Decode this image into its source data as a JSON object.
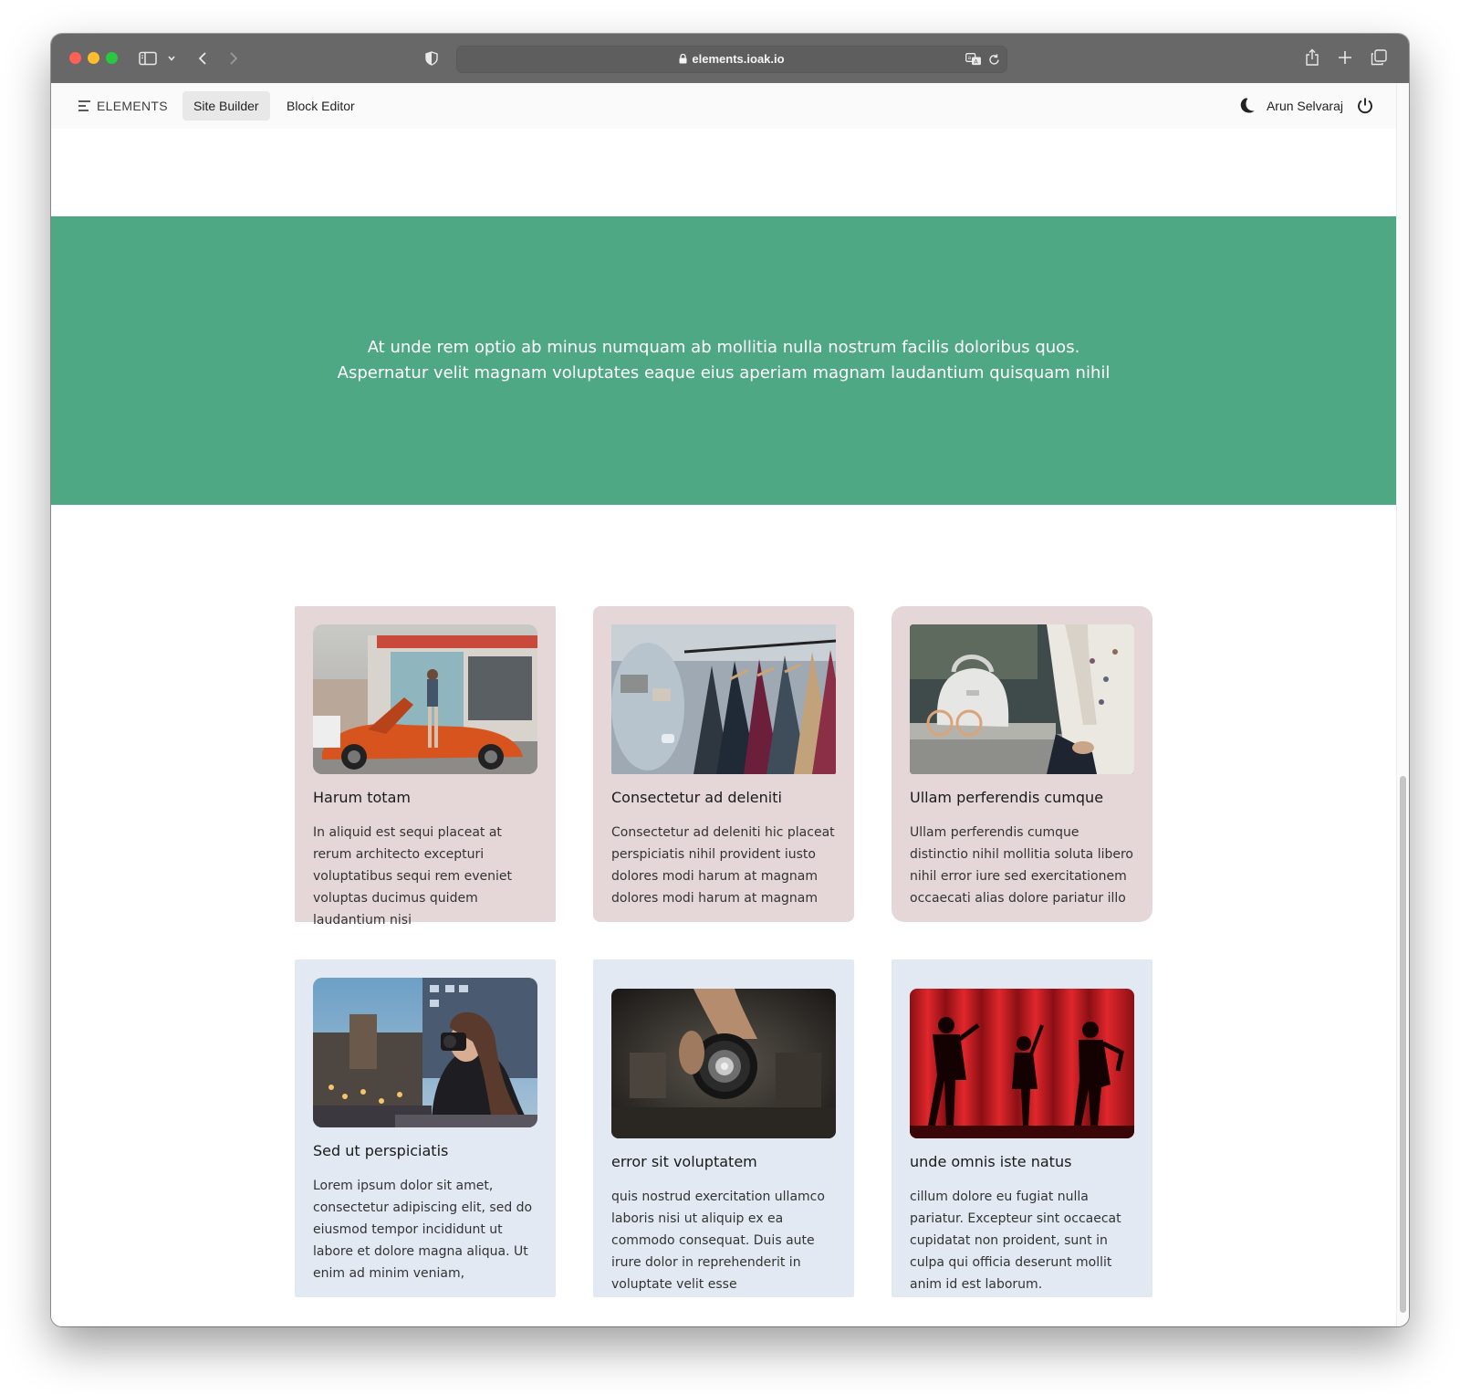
{
  "browser": {
    "url": "elements.ioak.io"
  },
  "nav": {
    "brand": "ELEMENTS",
    "tabs": [
      {
        "label": "Site Builder",
        "active": true
      },
      {
        "label": "Block Editor",
        "active": false
      }
    ],
    "user_name": "Arun Selvaraj"
  },
  "hero": {
    "text": "At unde rem optio ab minus numquam ab mollitia nulla nostrum facilis doloribus quos. Aspernatur velit magnam voluptates eaque eius aperiam magnam laudantium quisquam nihil",
    "background": "#4fa884"
  },
  "cards": [
    {
      "title": "Harum totam",
      "body": "In aliquid est sequi placeat at rerum architecto excepturi voluptatibus sequi rem eveniet voluptas ducimus quidem laudantium nisi",
      "image": "car-woman-photo"
    },
    {
      "title": "Consectetur ad deleniti",
      "body": "Consectetur ad deleniti hic placeat perspiciatis nihil provident iusto dolores modi harum at magnam dolores modi harum at magnam",
      "image": "clothing-rack-photo"
    },
    {
      "title": "Ullam perferendis cumque",
      "body": "Ullam perferendis cumque distinctio nihil mollitia soluta libero nihil error iure sed exercitationem occaecati alias dolore pariatur illo",
      "image": "handbag-photo"
    },
    {
      "title": "Sed ut perspiciatis",
      "body": "Lorem ipsum dolor sit amet, consectetur adipiscing elit, sed do eiusmod tempor incididunt ut labore et dolore magna aliqua. Ut enim ad minim veniam,",
      "image": "photographer-city-photo"
    },
    {
      "title": "error sit voluptatem",
      "body": "quis nostrud exercitation ullamco laboris nisi ut aliquip ex ea commodo consequat. Duis aute irure dolor in reprehenderit in voluptate velit esse",
      "image": "camera-lens-photo"
    },
    {
      "title": "unde omnis iste natus",
      "body": "cillum dolore eu fugiat nulla pariatur. Excepteur sint occaecat cupidatat non proident, sunt in culpa qui officia deserunt mollit anim id est laborum.",
      "image": "stage-curtain-photo"
    }
  ],
  "colors": {
    "card_pink": "#e5d7d7",
    "card_blue": "#e2e9f3"
  }
}
